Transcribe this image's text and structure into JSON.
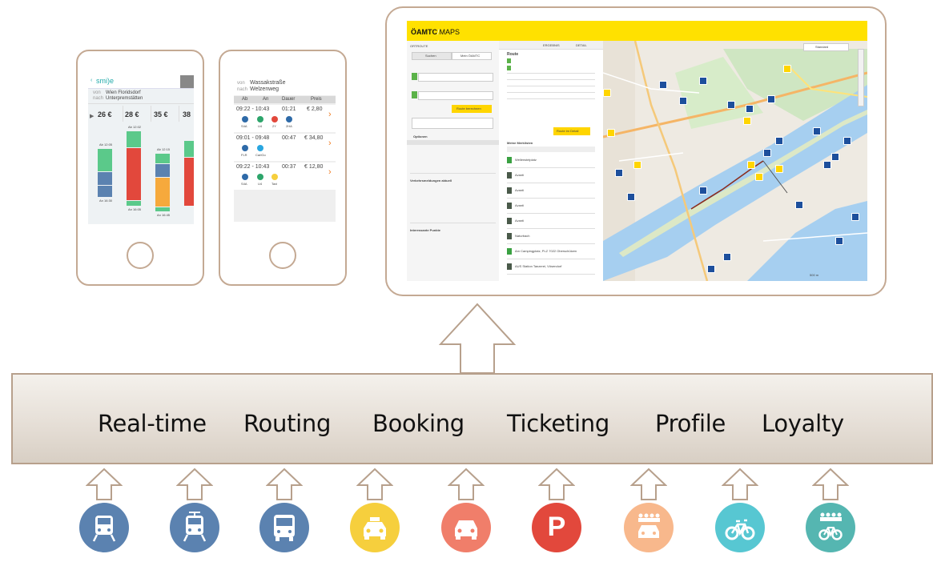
{
  "platform": {
    "features": [
      "Real-time",
      "Routing",
      "Booking",
      "Ticketing",
      "Profile",
      "Loyalty"
    ]
  },
  "modes": [
    {
      "icon": "train-icon",
      "color": "#5b82b0"
    },
    {
      "icon": "tram-icon",
      "color": "#5b82b0"
    },
    {
      "icon": "bus-icon",
      "color": "#5b82b0"
    },
    {
      "icon": "taxi-icon",
      "color": "#f6cf3d"
    },
    {
      "icon": "car-icon",
      "color": "#f07e6a"
    },
    {
      "icon": "parking-icon",
      "color": "#e2483c",
      "label": "P"
    },
    {
      "icon": "carpool-icon",
      "color": "#f8b88c"
    },
    {
      "icon": "bike-icon",
      "color": "#57c7d2"
    },
    {
      "icon": "bike-group-icon",
      "color": "#55b6b1"
    }
  ],
  "phone1": {
    "logo": "smi)e",
    "from_label": "von",
    "from": "Wien Floridsdorf",
    "to_label": "nach",
    "to": "Unterpremstätten",
    "prices": [
      "26 €",
      "28 €",
      "35 €",
      "38"
    ],
    "times": [
      "Ab 12:05",
      "Ab 12:02",
      "Ab 12:15",
      "Ab 12:05"
    ],
    "arrivals": [
      "An 16:30",
      "An 16:05",
      "An 16:45"
    ]
  },
  "phone2": {
    "from_label": "von",
    "from": "Wassakstraße",
    "to_label": "nach",
    "to": "Welzenweg",
    "headers": [
      "Ab",
      "An",
      "Dauer",
      "Preis"
    ],
    "rows": [
      {
        "time": "09:22 - 10:43",
        "dur": "01:21",
        "price": "€ 2,80",
        "legs": [
          "S4A",
          "U4",
          "2Y",
          "2HA"
        ]
      },
      {
        "time": "09:01 - 09:48",
        "dur": "00:47",
        "price": "€ 34,80",
        "legs": [
          "FLR",
          "CarlGo"
        ]
      },
      {
        "time": "09:22 - 10:43",
        "dur": "00:37",
        "price": "€ 12,80",
        "legs": [
          "S4A",
          "U4",
          "Taxi"
        ]
      }
    ]
  },
  "tablet": {
    "brand": "ÖAMTC",
    "brand2": "MAPS",
    "tab_left": "ORTROUTE",
    "tabs": [
      "ERGEBNIS",
      "DETAIL"
    ],
    "buttons": [
      "Suchen",
      "Mein ÖAMTC"
    ],
    "route_title": "Route",
    "route_btn": "Route berechnen",
    "detail_btn": "Route im Detail",
    "options_title": "Optionen",
    "list_title": "Meine Merklisten",
    "list_items": [
      "Wellenstelplatz",
      "Avanti",
      "Avanti",
      "Avanti",
      "Avanti",
      "Naturbach",
      "Am Campingplatz, PLZ 7022 Oberschützen",
      "AUS Station Tanzerei, Vösendorf"
    ],
    "traffic_title": "Verkehrsmeldungen aktuell",
    "poi_title": "Interessante Punkte",
    "map_mode": "Standard",
    "map_scale": "500 m"
  }
}
